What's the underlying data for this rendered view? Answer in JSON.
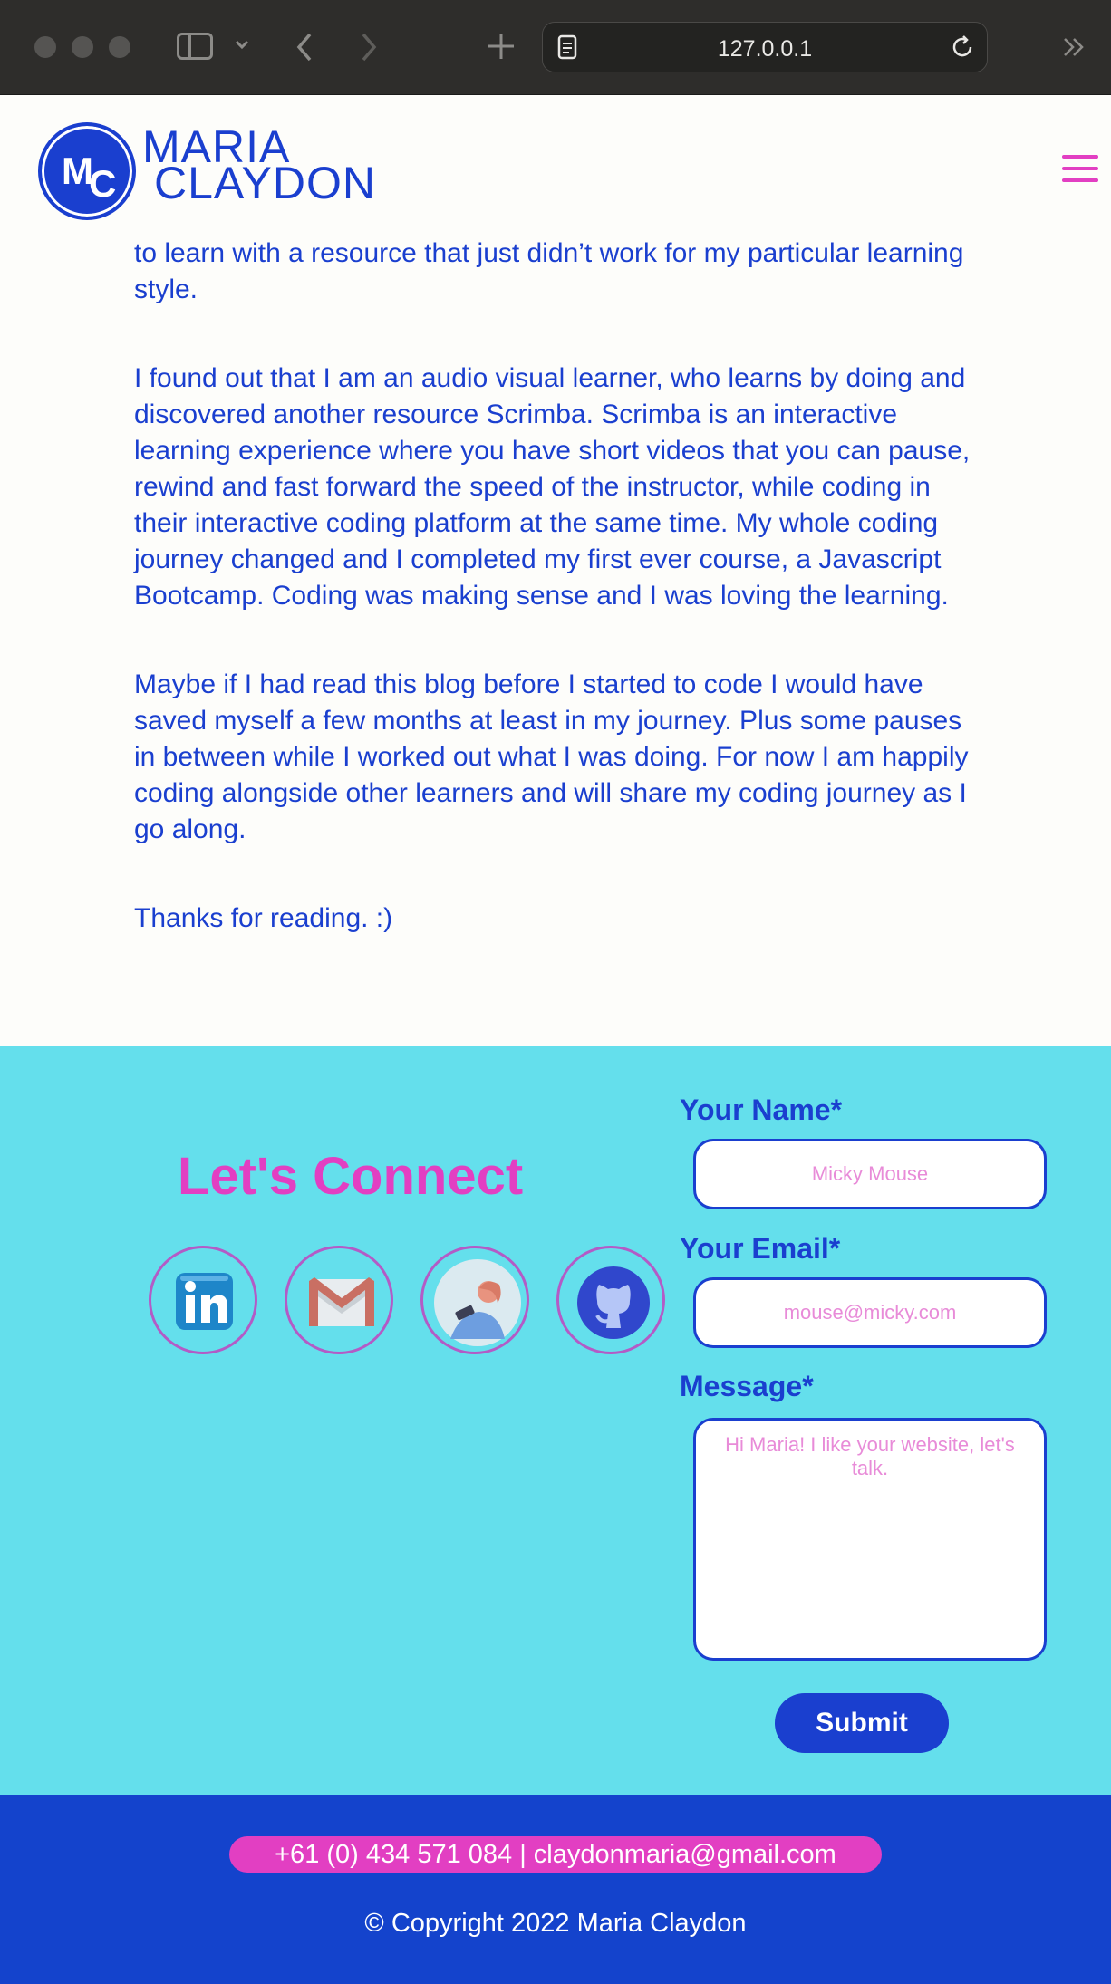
{
  "browser": {
    "url": "127.0.0.1"
  },
  "header": {
    "logo_initial_1": "M",
    "logo_initial_2": "C",
    "logo_line_1": "MARIA",
    "logo_line_2": "CLAYDON"
  },
  "blog": {
    "paragraphs": [
      "to learn with a resource that just didn’t work for my particular learning style.",
      "I found out that I am an audio visual learner, who learns by doing and discovered another resource Scrimba. Scrimba is an interactive learning experience where you have short videos that you can pause, rewind and fast forward the speed of the instructor, while coding in their interactive coding platform at the same time. My whole coding journey changed and I completed my first ever course, a Javascript Bootcamp. Coding was making sense and I was loving the learning.",
      "Maybe if I had read this blog before I started to code I would have saved myself a few months at least in my journey. Plus some pauses in between while I worked out what I was doing. For now I am happily coding alongside other learners and will share my coding journey as I go along.",
      "Thanks for reading. :)"
    ]
  },
  "connect": {
    "title": "Let's Connect",
    "social_icons": [
      "linkedin-icon",
      "gmail-icon",
      "blog-icon",
      "github-icon"
    ]
  },
  "form": {
    "name_label": "Your Name*",
    "name_placeholder": "Micky Mouse",
    "email_label": "Your Email*",
    "email_placeholder": "mouse@micky.com",
    "message_label": "Message*",
    "message_placeholder": "Hi Maria! I like your website, let's talk.",
    "submit_label": "Submit"
  },
  "footer": {
    "contact": "+61 (0) 434 571 084 | claydonmaria@gmail.com",
    "copyright": "© Copyright 2022 Maria Claydon"
  },
  "colors": {
    "brand_blue": "#1a3fcf",
    "accent_pink": "#e23fc2",
    "connect_bg": "#64dfec",
    "footer_bg": "#1443cc"
  }
}
